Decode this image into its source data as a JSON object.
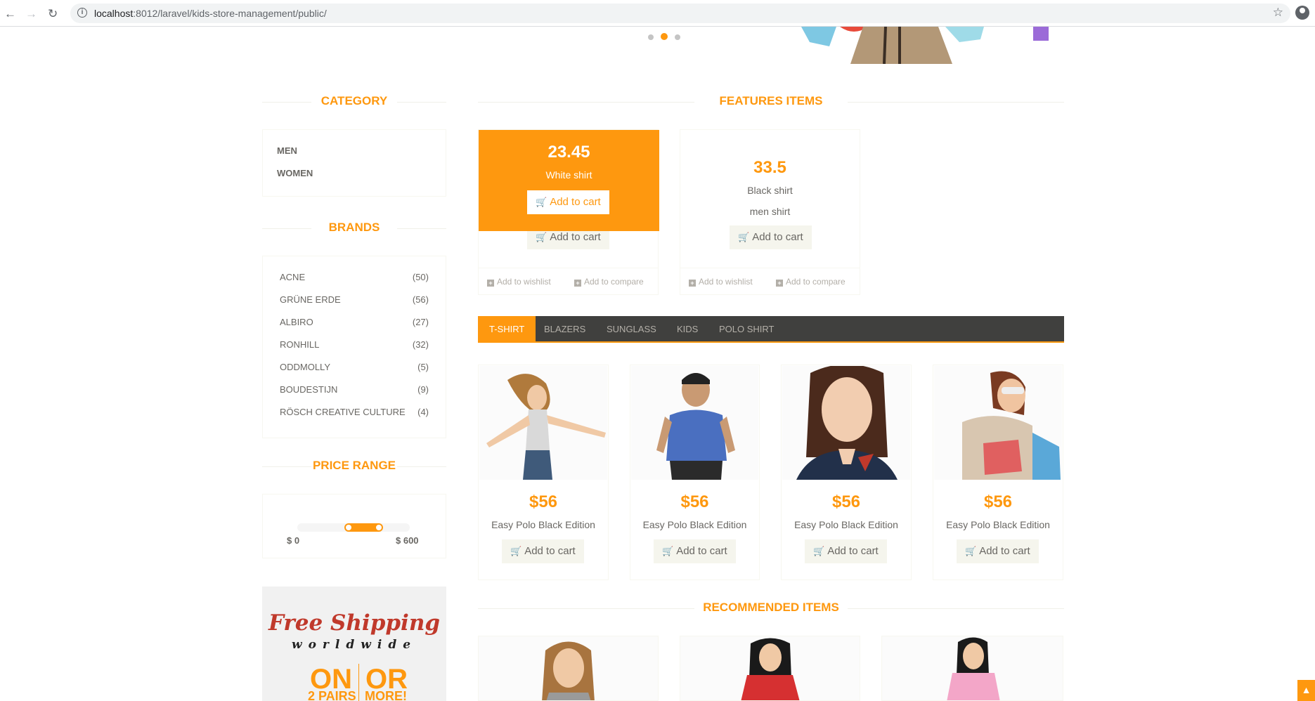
{
  "browser": {
    "url_host": "localhost",
    "url_rest": ":8012/laravel/kids-store-management/public/"
  },
  "sidebar": {
    "category_title": "CATEGORY",
    "categories": [
      "MEN",
      "WOMEN"
    ],
    "brands_title": "BRANDS",
    "brands": [
      {
        "name": "ACNE",
        "count": "(50)"
      },
      {
        "name": "GRÜNE ERDE",
        "count": "(56)"
      },
      {
        "name": "ALBIRO",
        "count": "(27)"
      },
      {
        "name": "RONHILL",
        "count": "(32)"
      },
      {
        "name": "ODDMOLLY",
        "count": "(5)"
      },
      {
        "name": "BOUDESTIJN",
        "count": "(9)"
      },
      {
        "name": "RÖSCH CREATIVE CULTURE",
        "count": "(4)"
      }
    ],
    "price_title": "PRICE RANGE",
    "price_min": "$ 0",
    "price_max": "$ 600",
    "price_slider": {
      "low_fraction": 0.4,
      "high_fraction": 0.62
    },
    "ad": {
      "line1": "Free Shipping",
      "line2": "worldwide",
      "on": "ON",
      "or": "OR",
      "pairs": "2 PAIRS",
      "more": "MORE!"
    }
  },
  "carousel": {
    "dots": 3,
    "active": 2
  },
  "features": {
    "title": "FEATURES ITEMS",
    "items": [
      {
        "price": "23.45",
        "name": "White shirt",
        "add": "Add to cart",
        "wishlist": "Add to wishlist",
        "compare": "Add to compare"
      },
      {
        "price": "33.5",
        "name": "Black shirt",
        "desc": "men shirt",
        "add": "Add to cart",
        "wishlist": "Add to wishlist",
        "compare": "Add to compare"
      }
    ]
  },
  "tabs": [
    "T-SHIRT",
    "BLAZERS",
    "SUNGLASS",
    "KIDS",
    "POLO SHIRT"
  ],
  "tab_products": [
    {
      "price": "$56",
      "name": "Easy Polo Black Edition",
      "add": "Add to cart"
    },
    {
      "price": "$56",
      "name": "Easy Polo Black Edition",
      "add": "Add to cart"
    },
    {
      "price": "$56",
      "name": "Easy Polo Black Edition",
      "add": "Add to cart"
    },
    {
      "price": "$56",
      "name": "Easy Polo Black Edition",
      "add": "Add to cart"
    }
  ],
  "recommended_title": "RECOMMENDED ITEMS",
  "colors": {
    "accent": "#FE980F",
    "tabbar": "#40403E",
    "text": "#696763"
  }
}
